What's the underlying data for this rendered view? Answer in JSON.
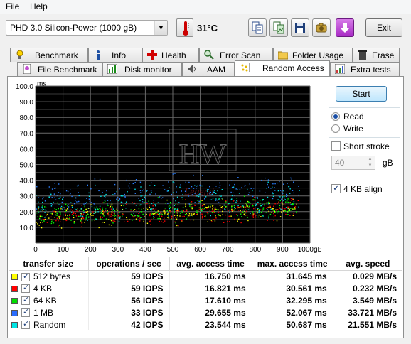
{
  "menu": {
    "file": "File",
    "help": "Help"
  },
  "toolbar": {
    "drive": "PHD 3.0 Silicon-Power   (1000 gB)",
    "temperature": "31°C",
    "exit_label": "Exit"
  },
  "tabs_top": [
    "Benchmark",
    "Info",
    "Health",
    "Error Scan",
    "Folder Usage",
    "Erase"
  ],
  "tabs_bottom": [
    "File Benchmark",
    "Disk monitor",
    "AAM",
    "Random Access",
    "Extra tests"
  ],
  "active_tab": "Random Access",
  "controls": {
    "start_label": "Start",
    "read_label": "Read",
    "write_label": "Write",
    "mode": "Read",
    "short_stroke_label": "Short stroke",
    "short_stroke_checked": false,
    "short_stroke_value": "40",
    "short_stroke_unit": "gB",
    "align_label": "4 KB align",
    "align_checked": true
  },
  "chart_data": {
    "type": "scatter",
    "ylabel": "ms",
    "xlabel": "gB",
    "ylim": [
      0,
      100
    ],
    "xlim": [
      0,
      1000
    ],
    "y_ticks": [
      "10.0",
      "20.0",
      "30.0",
      "40.0",
      "50.0",
      "60.0",
      "70.0",
      "80.0",
      "90.0",
      "100.0"
    ],
    "x_ticks": [
      "0",
      "100",
      "200",
      "300",
      "400",
      "500",
      "600",
      "700",
      "800",
      "900",
      "1000gB"
    ],
    "grid": true,
    "background": "#000000",
    "watermark": "HW Legend",
    "series": [
      {
        "name": "512 bytes",
        "color": "#ffff00",
        "approx_min_ms": 9,
        "approx_max_ms": 31,
        "center_ms": 16.75
      },
      {
        "name": "4 KB",
        "color": "#ff0000",
        "approx_min_ms": 8,
        "approx_max_ms": 30,
        "center_ms": 16.8
      },
      {
        "name": "64 KB",
        "color": "#00ff00",
        "approx_min_ms": 9,
        "approx_max_ms": 32,
        "center_ms": 17.6
      },
      {
        "name": "1 MB",
        "color": "#2a7fff",
        "approx_min_ms": 22,
        "approx_max_ms": 52,
        "center_ms": 29.7
      },
      {
        "name": "Random",
        "color": "#00e5e5",
        "approx_min_ms": 12,
        "approx_max_ms": 50,
        "center_ms": 23.5
      }
    ]
  },
  "results": {
    "headers": [
      "transfer size",
      "operations / sec",
      "avg. access time",
      "max. access time",
      "avg. speed"
    ],
    "rows": [
      {
        "color": "#ffff00",
        "label": "512 bytes",
        "ops": "59 IOPS",
        "avg": "16.750 ms",
        "max": "31.645 ms",
        "speed": "0.029 MB/s"
      },
      {
        "color": "#ff0000",
        "label": "4 KB",
        "ops": "59 IOPS",
        "avg": "16.821 ms",
        "max": "30.561 ms",
        "speed": "0.232 MB/s"
      },
      {
        "color": "#00dd00",
        "label": "64 KB",
        "ops": "56 IOPS",
        "avg": "17.610 ms",
        "max": "32.295 ms",
        "speed": "3.549 MB/s"
      },
      {
        "color": "#2a6dff",
        "label": "1 MB",
        "ops": "33 IOPS",
        "avg": "29.655 ms",
        "max": "52.067 ms",
        "speed": "33.721 MB/s"
      },
      {
        "color": "#00e5e5",
        "label": "Random",
        "ops": "42 IOPS",
        "avg": "23.544 ms",
        "max": "50.687 ms",
        "speed": "21.551 MB/s"
      }
    ]
  }
}
